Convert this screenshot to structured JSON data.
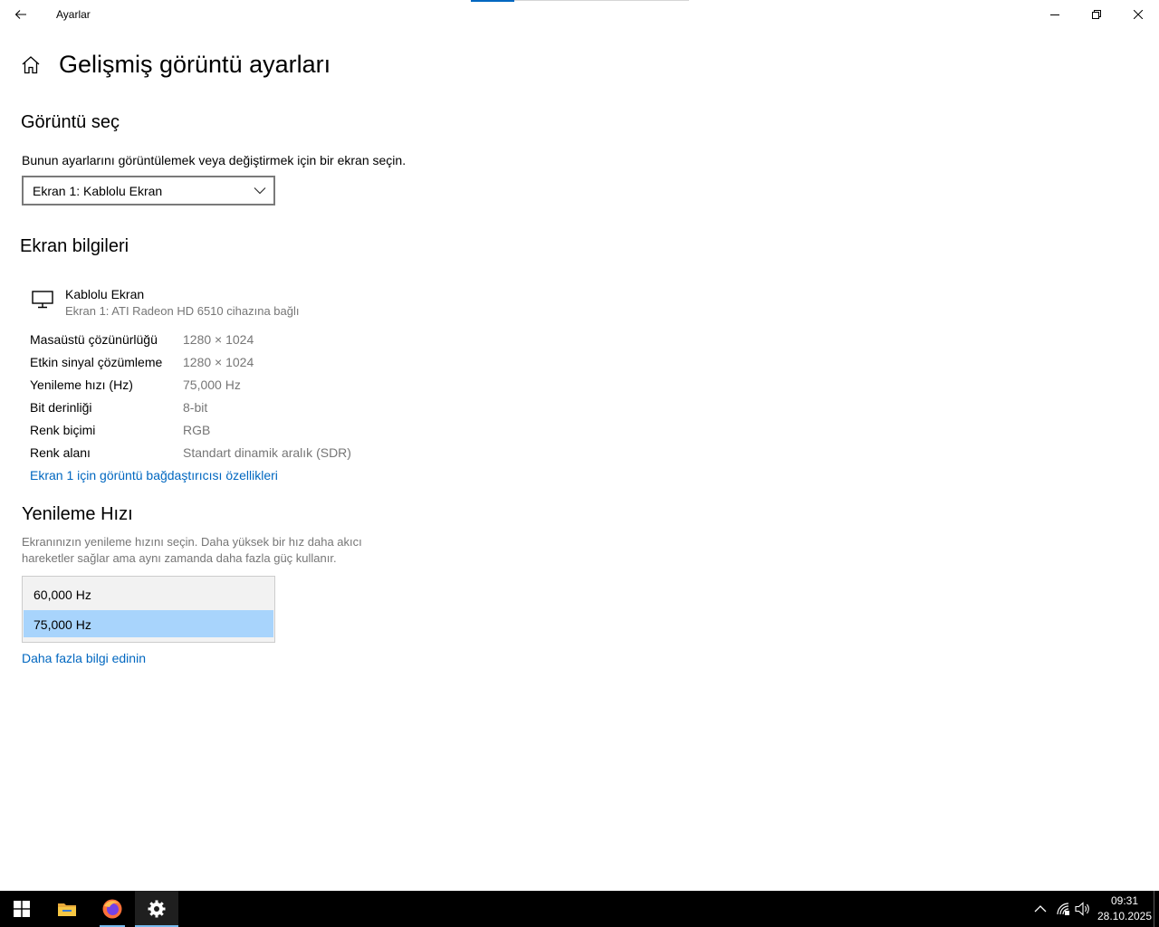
{
  "window": {
    "app_title": "Ayarlar",
    "progress_percent": 20
  },
  "page": {
    "title": "Gelişmiş görüntü ayarları"
  },
  "select_display": {
    "heading": "Görüntü seç",
    "description": "Bunun ayarlarını görüntülemek veya değiştirmek için bir ekran seçin.",
    "selected_value": "Ekran 1: Kablolu Ekran"
  },
  "display_info": {
    "heading": "Ekran bilgileri",
    "monitor_name": "Kablolu Ekran",
    "monitor_connection": "Ekran 1: ATI Radeon HD 6510 cihazına bağlı",
    "rows": [
      {
        "label": "Masaüstü çözünürlüğü",
        "value": "1280 × 1024"
      },
      {
        "label": "Etkin sinyal çözümleme",
        "value": "1280 × 1024"
      },
      {
        "label": "Yenileme hızı (Hz)",
        "value": "75,000 Hz"
      },
      {
        "label": "Bit derinliği",
        "value": "8-bit"
      },
      {
        "label": "Renk biçimi",
        "value": "RGB"
      },
      {
        "label": "Renk alanı",
        "value": "Standart dinamik aralık (SDR)"
      }
    ],
    "adapter_link": "Ekran 1 için görüntü bağdaştırıcısı özellikleri"
  },
  "refresh_rate": {
    "heading": "Yenileme Hızı",
    "description_line1": "Ekranınızın yenileme hızını seçin. Daha yüksek bir hız daha akıcı",
    "description_line2": "hareketler sağlar ama aynı zamanda daha fazla güç kullanır.",
    "options": [
      "60,000 Hz",
      "75,000 Hz"
    ],
    "selected": "75,000 Hz",
    "learn_more_link": "Daha fazla bilgi edinin"
  },
  "taskbar": {
    "time": "09:31",
    "date": "28.10.2025",
    "apps": [
      "start-icon",
      "file-explorer-icon",
      "firefox-icon",
      "settings-icon"
    ]
  },
  "colors": {
    "accent": "#0067c0",
    "selection": "#a8d4fc",
    "taskbar": "#000000"
  }
}
